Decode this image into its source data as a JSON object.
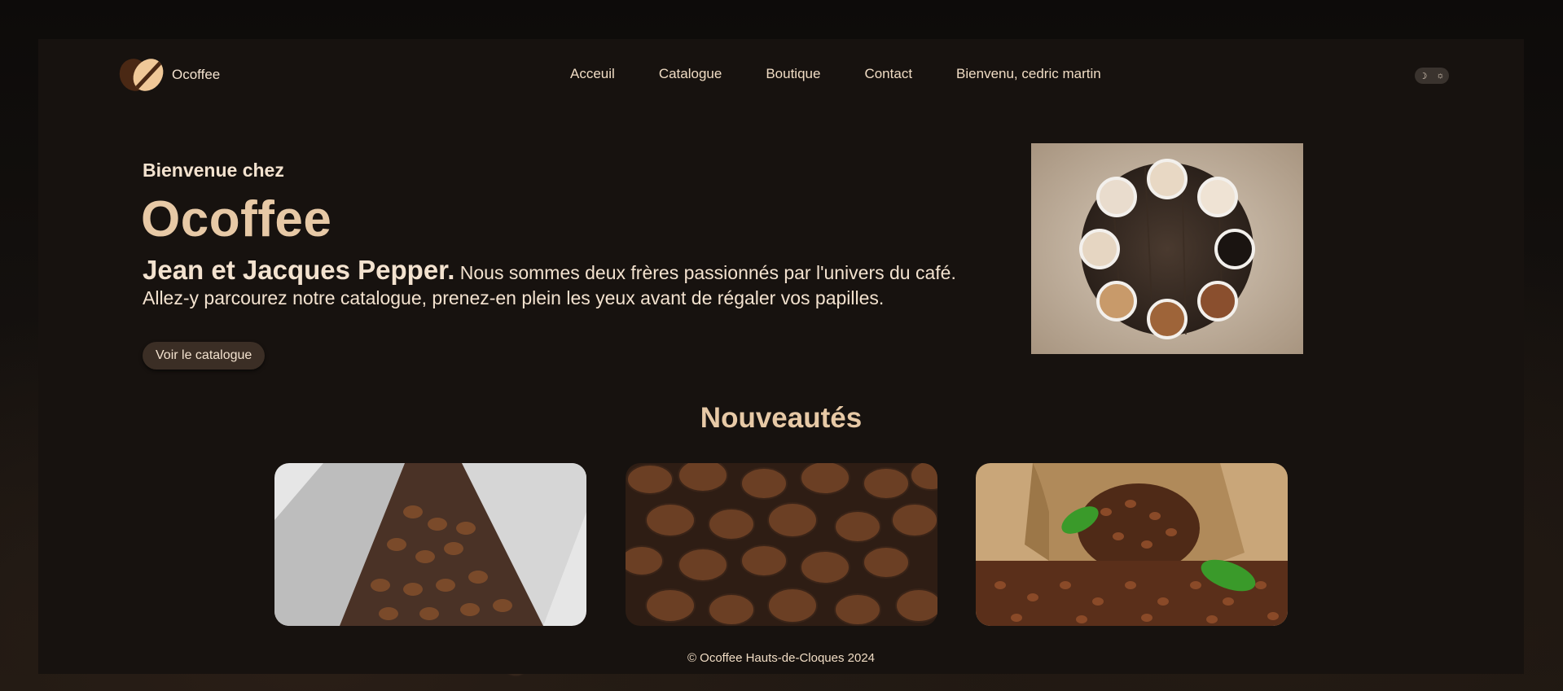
{
  "brand": {
    "name": "Ocoffee"
  },
  "nav": {
    "items": [
      "Acceuil",
      "Catalogue",
      "Boutique",
      "Contact",
      "Bienvenu, cedric martin"
    ]
  },
  "theme_toggle": {
    "moon": "☽",
    "sun": "☼"
  },
  "hero": {
    "subtitle": "Bienvenue chez",
    "title": "Ocoffee",
    "names": "Jean et Jacques Pepper.",
    "line1": " Nous sommes deux frères passionnés par l'univers du café.",
    "line2": "Allez-y parcourez notre catalogue, prenez-en plein les yeux avant de régaler vos papilles.",
    "button_label": "Voir le catalogue",
    "image_icon": "coffee-cups-table-image"
  },
  "news": {
    "title": "Nouveautés",
    "cards": [
      {
        "icon": "coffee-bag-image"
      },
      {
        "icon": "coffee-beans-closeup-image"
      },
      {
        "icon": "coffee-sack-image"
      }
    ]
  },
  "footer": {
    "text": "© Ocoffee Hauts-de-Cloques 2024"
  },
  "colors": {
    "background": "#17120f",
    "accent": "#e7c9a6",
    "text": "#f3e2cf",
    "button": "#3b2e25"
  }
}
